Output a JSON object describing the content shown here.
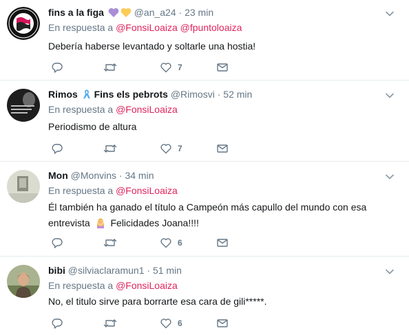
{
  "colors": {
    "accent": "#e0245e",
    "muted": "#657786",
    "text": "#14171a",
    "divider": "#e6ecf0"
  },
  "tweets": [
    {
      "display_name": "fins a la figa",
      "name_emojis": [
        "purple-heart-icon",
        "yellow-heart-icon"
      ],
      "handle": "@an_a24",
      "separator": "·",
      "time": "23 min",
      "reply_prefix": "En respuesta a",
      "mentions": [
        "@FonsiLoaiza",
        "@fpuntoloaiza"
      ],
      "text": "Debería haberse levantado y soltarle una hostia!",
      "actions": {
        "reply_count": "",
        "retweet_count": "",
        "like_count": "7"
      },
      "icons": [
        "reply-icon",
        "retweet-icon",
        "like-icon",
        "message-icon",
        "chevron-down-icon"
      ]
    },
    {
      "display_name": "Rimos",
      "name_emojis": [
        "ribbon-icon"
      ],
      "display_name_suffix": "Fins els pebrots",
      "handle": "@Rimosvi",
      "separator": "·",
      "time": "52 min",
      "reply_prefix": "En respuesta a",
      "mentions": [
        "@FonsiLoaiza"
      ],
      "text": "Periodismo de altura",
      "actions": {
        "reply_count": "",
        "retweet_count": "",
        "like_count": "7"
      }
    },
    {
      "display_name": "Mon",
      "handle": "@Monvins",
      "separator": "·",
      "time": "34 min",
      "reply_prefix": "En respuesta a",
      "mentions": [
        "@FonsiLoaiza"
      ],
      "text_line1": "Él también ha ganado el título a Campeón más capullo del mundo con esa",
      "text_line2_before": "entrevista",
      "text_line2_emoji": "person-facepalming-icon",
      "text_line2_after": "Felicidades Joana!!!!",
      "actions": {
        "reply_count": "",
        "retweet_count": "",
        "like_count": "6"
      }
    },
    {
      "display_name": "bibi",
      "handle": "@silviaclaramun1",
      "separator": "·",
      "time": "51 min",
      "reply_prefix": "En respuesta a",
      "mentions": [
        "@FonsiLoaiza"
      ],
      "text": "No, el titulo sirve para borrarte esa cara de gili*****.",
      "actions": {
        "reply_count": "",
        "retweet_count": "",
        "like_count": "6"
      }
    }
  ]
}
